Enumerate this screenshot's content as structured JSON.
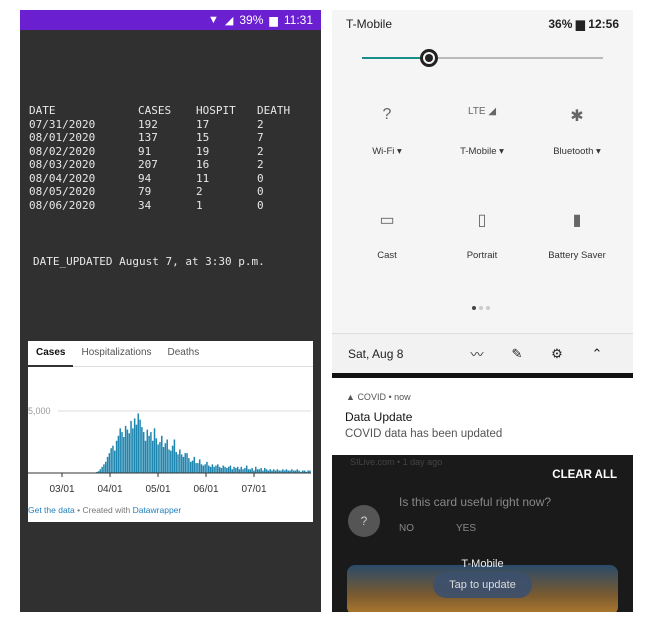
{
  "left_phone": {
    "status": {
      "battery": "39%",
      "time": "11:31"
    },
    "table": {
      "headers": [
        "DATE",
        "CASES",
        "HOSPIT",
        "DEATH"
      ],
      "rows": [
        [
          "07/31/2020",
          "192",
          "17",
          "2"
        ],
        [
          "08/01/2020",
          "137",
          "15",
          "7"
        ],
        [
          "08/02/2020",
          "91",
          "19",
          "2"
        ],
        [
          "08/03/2020",
          "207",
          "16",
          "2"
        ],
        [
          "08/04/2020",
          "94",
          "11",
          "0"
        ],
        [
          "08/05/2020",
          "79",
          "2",
          "0"
        ],
        [
          "08/06/2020",
          "34",
          "1",
          "0"
        ]
      ]
    },
    "date_updated": "DATE_UPDATED August 7, at 3:30 p.m.",
    "chart_tabs": [
      "Cases",
      "Hospitalizations",
      "Deaths"
    ],
    "credit": {
      "link1": "Get the data",
      "sep": " • Created with ",
      "link2": "Datawrapper"
    }
  },
  "chart_data": {
    "type": "bar",
    "ytick": "5,000",
    "xtick_labels": [
      "03/01",
      "04/01",
      "05/01",
      "06/01",
      "07/01"
    ],
    "color": "#1f86b0",
    "note": "daily cases; values estimated relative to the 5,000 gridline",
    "values": [
      0,
      0,
      0,
      0,
      0,
      0,
      0,
      0,
      0,
      0,
      0,
      0,
      0,
      0,
      0,
      0,
      0,
      0,
      0,
      0,
      30,
      80,
      150,
      300,
      500,
      700,
      900,
      1300,
      1600,
      2000,
      2200,
      1800,
      2600,
      3000,
      3600,
      3300,
      2900,
      3800,
      3500,
      3200,
      4200,
      3600,
      4400,
      3900,
      4800,
      4300,
      3700,
      3300,
      2600,
      3500,
      3000,
      3300,
      2600,
      3600,
      2800,
      2300,
      2500,
      3000,
      2100,
      2400,
      2700,
      1900,
      1800,
      2200,
      2700,
      1700,
      1500,
      1900,
      1500,
      1300,
      1600,
      1600,
      1200,
      900,
      1000,
      1300,
      800,
      800,
      1100,
      700,
      600,
      700,
      900,
      600,
      500,
      700,
      500,
      600,
      700,
      500,
      400,
      600,
      500,
      400,
      500,
      600,
      300,
      500,
      400,
      500,
      300,
      500,
      300,
      400,
      600,
      300,
      300,
      400,
      200,
      500,
      300,
      300,
      400,
      200,
      400,
      300,
      200,
      300,
      200,
      300,
      200,
      300,
      200,
      200,
      300,
      200,
      300,
      200,
      200,
      300,
      200,
      200,
      300,
      200,
      100,
      200,
      200,
      100,
      200,
      200
    ]
  },
  "right_phone": {
    "status": {
      "carrier": "T-Mobile",
      "battery": "36%",
      "time": "12:56"
    },
    "tiles": [
      {
        "label": "Wi-Fi ▾",
        "icon": "wifi-question-icon",
        "glyph": "?"
      },
      {
        "label": "T-Mobile ▾",
        "icon": "lte-signal-icon",
        "glyph": "LTE ◢"
      },
      {
        "label": "Bluetooth ▾",
        "icon": "bluetooth-off-icon",
        "glyph": "✱"
      },
      {
        "label": "Cast",
        "icon": "cast-icon",
        "glyph": "▭"
      },
      {
        "label": "Portrait",
        "icon": "portrait-icon",
        "glyph": "▯"
      },
      {
        "label": "Battery Saver",
        "icon": "battery-saver-icon",
        "glyph": "▮"
      }
    ],
    "date": "Sat, Aug 8",
    "notification": {
      "app": "COVID • now",
      "title": "Data Update",
      "message": "COVID data has been updated"
    },
    "behind": {
      "faint": "SILive.com • 1 day ago",
      "clear_all": "CLEAR ALL",
      "question": "Is this card useful right now?",
      "no": "NO",
      "yes": "YES",
      "card_title": "T-Mobile",
      "card_button": "Tap to update"
    }
  }
}
